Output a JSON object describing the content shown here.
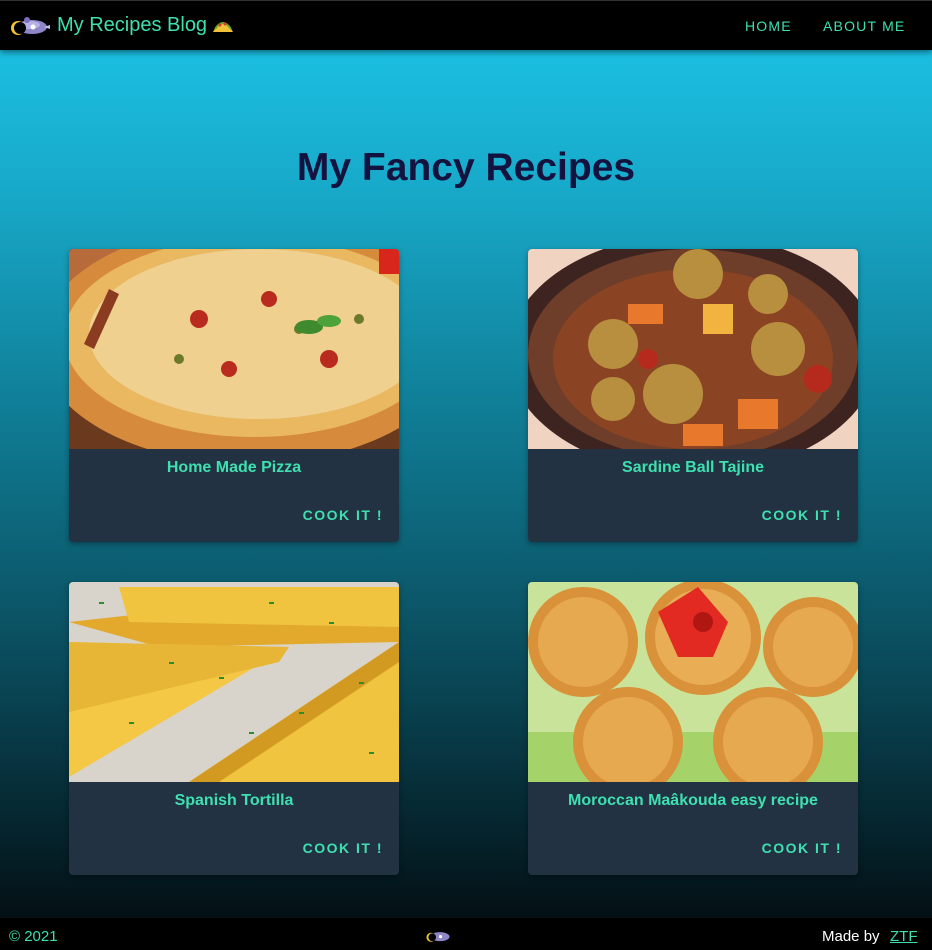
{
  "header": {
    "brand": "My Recipes Blog",
    "nav": {
      "home": "HOME",
      "about": "ABOUT ME"
    }
  },
  "main": {
    "title": "My Fancy Recipes",
    "cards": [
      {
        "title": "Home Made Pizza",
        "action": "COOK IT !"
      },
      {
        "title": "Sardine Ball Tajine",
        "action": "COOK IT !"
      },
      {
        "title": "Spanish Tortilla",
        "action": "COOK IT !"
      },
      {
        "title": "Moroccan Maâkouda easy recipe",
        "action": "COOK IT !"
      }
    ]
  },
  "footer": {
    "copyright": "© 2021",
    "made_by": "Made by",
    "author": "ZTF"
  },
  "colors": {
    "accent": "#3ee0b0",
    "navbar": "#000000",
    "card": "#223243",
    "title": "#14123f"
  },
  "icons": {
    "logo": "rocket-logo-icon",
    "taco": "taco-icon"
  }
}
